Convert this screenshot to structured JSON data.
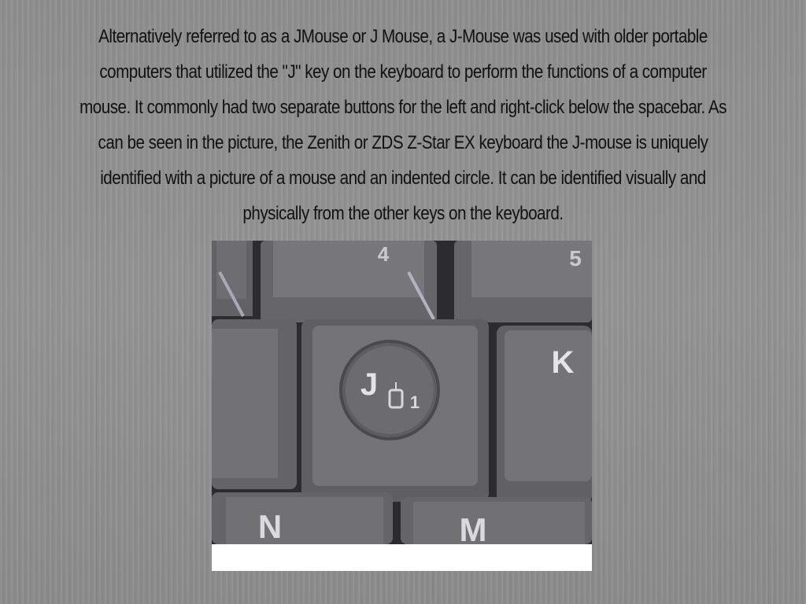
{
  "slide": {
    "paragraph": "Alternatively referred to as a JMouse or J Mouse, a J-Mouse was used with older portable computers that utilized the \"J\" key on the keyboard to perform the functions of a computer mouse. It commonly had two separate buttons for the left and right-click below the spacebar. As can be seen in the picture, the Zenith or ZDS Z-Star EX keyboard the J-mouse is uniquely identified with a picture of a mouse and an indented circle. It can be identified visually and physically from the other keys on the keyboard."
  },
  "photo": {
    "keys": {
      "top_left": "4",
      "top_right": "5",
      "center": "J",
      "center_sub": "1",
      "right": "K",
      "bottom_left": "N",
      "bottom_right": "M"
    },
    "colors": {
      "key": "#6a6a6e",
      "key_top": "#77777b",
      "gap": "#2c2c30",
      "legend": "#d9d9df"
    }
  }
}
